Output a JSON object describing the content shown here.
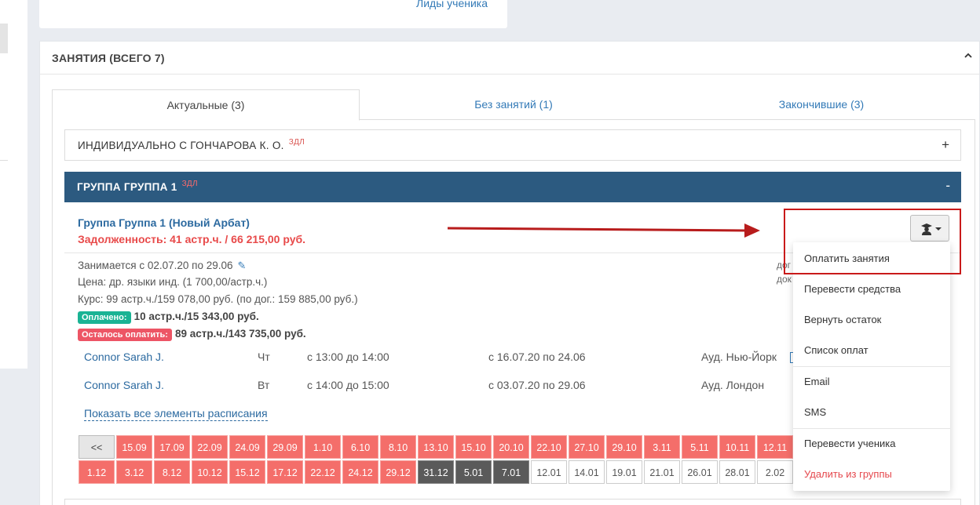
{
  "top_card": {
    "link": "Лиды ученика"
  },
  "panel": {
    "title": "ЗАНЯТИЯ (ВСЕГО 7)"
  },
  "tabs": [
    {
      "label": "Актуальные (3)",
      "active": true
    },
    {
      "label": "Без занятий (1)",
      "active": false
    },
    {
      "label": "Закончившие (3)",
      "active": false
    }
  ],
  "accordions": [
    {
      "title": "ИНДИВИДУАЛЬНО С ГОНЧАРОВА К. О.",
      "tag": "ЗДЛ",
      "sign": "+"
    },
    {
      "title": "ГРУППА ГРУППА 1",
      "tag": "ЗДЛ",
      "sign": "-"
    }
  ],
  "group": {
    "name": "Группа Группа 1 (Новый Арбат)",
    "debt": "Задолженность: 41 астр.ч. / 66 215,00 руб.",
    "period": "Занимается с 02.07.20 по 29.06",
    "price": "Цена: др. языки инд. (1 700,00/астр.ч.)",
    "course": "Курс: 99 астр.ч./159 078,00 руб. (по дог.: 159 885,00 руб.)",
    "paid_label": "Оплачено:",
    "paid_value": "10 астр.ч./15 343,00 руб.",
    "remain_label": "Осталось оплатить:",
    "remain_value": "89 астр.ч./143 735,00 руб."
  },
  "schedule": [
    {
      "teacher": "Connor Sarah J.",
      "day": "Чт",
      "time": "с 13:00 до 14:00",
      "dates": "с 16.07.20 по 24.06",
      "room": "Ауд. Нью-Йорк"
    },
    {
      "teacher": "Connor Sarah J.",
      "day": "Вт",
      "time": "с 14:00 до 15:00",
      "dates": "с 03.07.20 по 29.06",
      "room": "Ауд. Лондон"
    }
  ],
  "show_all": "Показать все элементы расписания",
  "bg_text": [
    "дог",
    "док"
  ],
  "calendar": {
    "nav": "<<",
    "row1": [
      "15.09",
      "17.09",
      "22.09",
      "24.09",
      "29.09",
      "1.10",
      "6.10",
      "8.10",
      "13.10",
      "15.10",
      "20.10",
      "22.10",
      "27.10",
      "29.10",
      "3.11",
      "5.11",
      "10.11",
      "12.11"
    ],
    "row2": [
      {
        "d": "1.12",
        "s": "red"
      },
      {
        "d": "3.12",
        "s": "red"
      },
      {
        "d": "8.12",
        "s": "red"
      },
      {
        "d": "10.12",
        "s": "red"
      },
      {
        "d": "15.12",
        "s": "red"
      },
      {
        "d": "17.12",
        "s": "red"
      },
      {
        "d": "22.12",
        "s": "red"
      },
      {
        "d": "24.12",
        "s": "red"
      },
      {
        "d": "29.12",
        "s": "red"
      },
      {
        "d": "31.12",
        "s": "dark"
      },
      {
        "d": "5.01",
        "s": "dark"
      },
      {
        "d": "7.01",
        "s": "dark"
      },
      {
        "d": "12.01",
        "s": "white"
      },
      {
        "d": "14.01",
        "s": "white"
      },
      {
        "d": "19.01",
        "s": "white"
      },
      {
        "d": "21.01",
        "s": "white"
      },
      {
        "d": "26.01",
        "s": "white"
      },
      {
        "d": "28.01",
        "s": "white"
      },
      {
        "d": "2.02",
        "s": "white"
      }
    ]
  },
  "dropdown": {
    "items": [
      "Оплатить занятия",
      "Перевести средства",
      "Вернуть остаток",
      "Список оплат",
      "Email",
      "SMS",
      "Перевести ученика",
      "Удалить из группы"
    ]
  },
  "colors": {
    "accent": "#2c5a80",
    "danger": "#e84a4a",
    "paid": "#1ab394",
    "remain": "#ed5565",
    "calendar_red": "#f46e6a",
    "calendar_dark": "#5a5a5a"
  },
  "icons": {
    "dropdown_button": "student-icon",
    "panel_toggle": "chevron-up-icon",
    "edit": "pencil-icon",
    "annotation": "arrow-right-icon"
  }
}
